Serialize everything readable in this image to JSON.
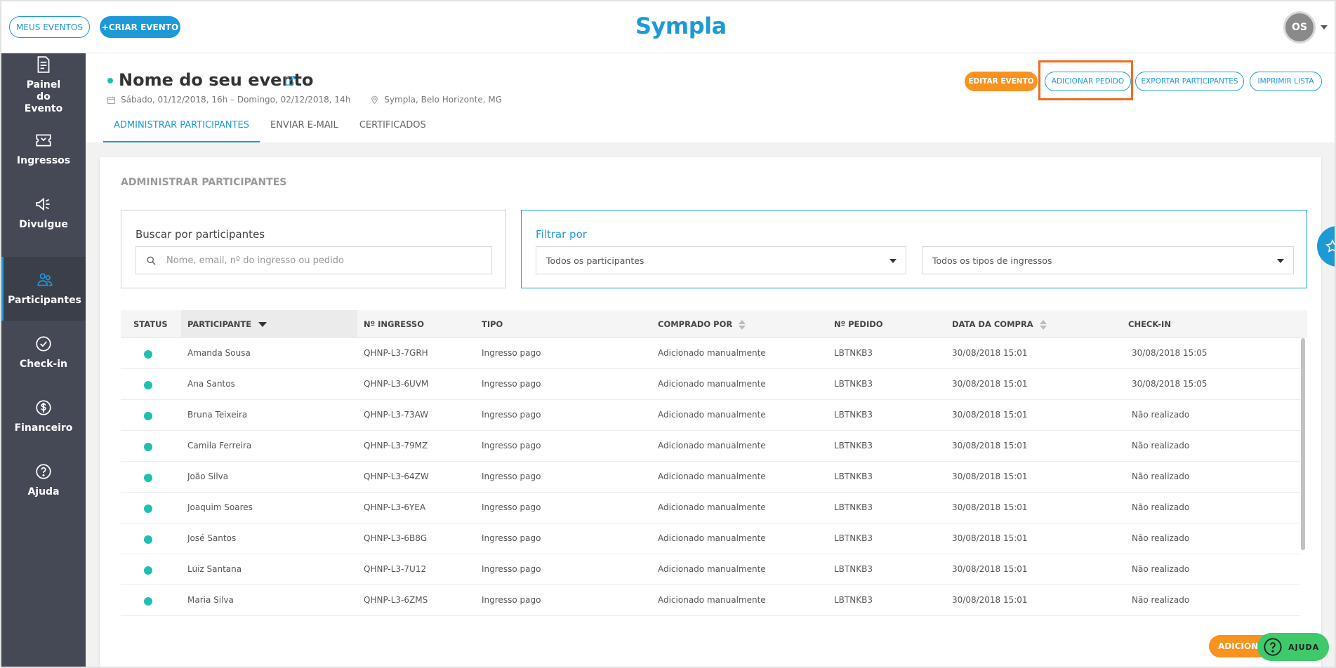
{
  "topbar": {
    "meus_eventos": "MEUS EVENTOS",
    "criar_evento": "+CRIAR EVENTO",
    "logo": "Sympla",
    "avatar_initials": "OS"
  },
  "sidebar": {
    "items": [
      {
        "label": "Painel do Evento",
        "icon": "dashboard-icon"
      },
      {
        "label": "Ingressos",
        "icon": "ticket-icon"
      },
      {
        "label": "Divulgue",
        "icon": "megaphone-icon"
      },
      {
        "label": "Participantes",
        "icon": "people-icon"
      },
      {
        "label": "Check-in",
        "icon": "check-circle-icon"
      },
      {
        "label": "Financeiro",
        "icon": "dollar-circle-icon"
      },
      {
        "label": "Ajuda",
        "icon": "question-circle-icon"
      }
    ]
  },
  "event": {
    "title": "Nome do seu evento",
    "date": "Sábado, 01/12/2018, 16h – Domingo, 02/12/2018, 14h",
    "location": "Sympla, Belo Horizonte, MG"
  },
  "header_buttons": {
    "editar": "EDITAR EVENTO",
    "adicionar": "ADICIONAR PEDIDO",
    "exportar": "EXPORTAR PARTICIPANTES",
    "imprimir": "IMPRIMIR LISTA"
  },
  "tabs": [
    "ADMINISTRAR PARTICIPANTES",
    "ENVIAR E-MAIL",
    "CERTIFICADOS"
  ],
  "main": {
    "section_title": "ADMINISTRAR PARTICIPANTES",
    "search_label": "Buscar por participantes",
    "search_placeholder": "Nome, email, nº do ingresso ou pedido",
    "filter_label": "Filtrar por",
    "filter_participants": "Todos os participantes",
    "filter_tickets": "Todos os tipos de ingressos"
  },
  "table": {
    "headers": [
      "STATUS",
      "PARTICIPANTE",
      "Nº INGRESSO",
      "TIPO",
      "COMPRADO POR",
      "Nº PEDIDO",
      "DATA DA COMPRA",
      "CHECK-IN"
    ],
    "rows": [
      {
        "participante": "Amanda Sousa",
        "ingresso": "QHNP-L3-7GRH",
        "tipo": "Ingresso pago",
        "comprado_por": "Adicionado manualmente",
        "pedido": "LBTNKB3",
        "data": "30/08/2018 15:01",
        "checkin": "30/08/2018 15:05"
      },
      {
        "participante": "Ana Santos",
        "ingresso": "QHNP-L3-6UVM",
        "tipo": "Ingresso pago",
        "comprado_por": "Adicionado manualmente",
        "pedido": "LBTNKB3",
        "data": "30/08/2018 15:01",
        "checkin": "30/08/2018 15:05"
      },
      {
        "participante": "Bruna Teixeira",
        "ingresso": "QHNP-L3-73AW",
        "tipo": "Ingresso pago",
        "comprado_por": "Adicionado manualmente",
        "pedido": "LBTNKB3",
        "data": "30/08/2018 15:01",
        "checkin": "Não realizado"
      },
      {
        "participante": "Camila Ferreira",
        "ingresso": "QHNP-L3-79MZ",
        "tipo": "Ingresso pago",
        "comprado_por": "Adicionado manualmente",
        "pedido": "LBTNKB3",
        "data": "30/08/2018 15:01",
        "checkin": "Não realizado"
      },
      {
        "participante": "João Silva",
        "ingresso": "QHNP-L3-64ZW",
        "tipo": "Ingresso pago",
        "comprado_por": "Adicionado manualmente",
        "pedido": "LBTNKB3",
        "data": "30/08/2018 15:01",
        "checkin": "Não realizado"
      },
      {
        "participante": "Joaquim Soares",
        "ingresso": "QHNP-L3-6YEA",
        "tipo": "Ingresso pago",
        "comprado_por": "Adicionado manualmente",
        "pedido": "LBTNKB3",
        "data": "30/08/2018 15:01",
        "checkin": "Não realizado"
      },
      {
        "participante": "José Santos",
        "ingresso": "QHNP-L3-6B8G",
        "tipo": "Ingresso pago",
        "comprado_por": "Adicionado manualmente",
        "pedido": "LBTNKB3",
        "data": "30/08/2018 15:01",
        "checkin": "Não realizado"
      },
      {
        "participante": "Luiz Santana",
        "ingresso": "QHNP-L3-7U12",
        "tipo": "Ingresso pago",
        "comprado_por": "Adicionado manualmente",
        "pedido": "LBTNKB3",
        "data": "30/08/2018 15:01",
        "checkin": "Não realizado"
      },
      {
        "participante": "Maria Silva",
        "ingresso": "QHNP-L3-6ZMS",
        "tipo": "Ingresso pago",
        "comprado_por": "Adicionado manualmente",
        "pedido": "LBTNKB3",
        "data": "30/08/2018 15:01",
        "checkin": "Não realizado"
      }
    ]
  },
  "floating": {
    "adicionar": "ADICIONAR",
    "ajuda": "AJUDA"
  },
  "colors": {
    "brand_blue": "#1d9ad6",
    "orange": "#f7931e",
    "highlight": "#f26b1d",
    "sidebar": "#454955",
    "status_green": "#1ec0b0",
    "help_green": "#3ec96b"
  }
}
